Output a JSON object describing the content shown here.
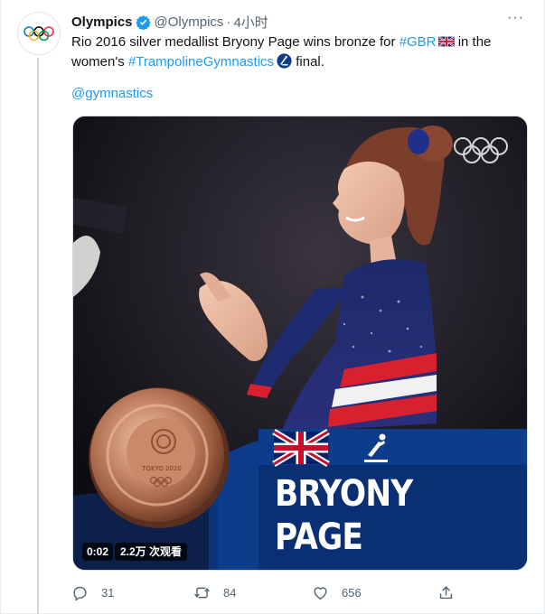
{
  "tweet": {
    "author_name": "Olympics",
    "handle": "@Olympics",
    "separator": "·",
    "time": "4小时",
    "more_label": "···",
    "text_part1": "Rio 2016 silver medallist Bryony Page wins bronze for ",
    "hashtag1": "#GBR",
    "text_part2": " in the women's ",
    "hashtag2": "#TrampolineGymnastics",
    "text_part3": " final.",
    "mention": "@gymnastics"
  },
  "media": {
    "athlete_first_name": "BRYONY",
    "athlete_last_name": "PAGE",
    "medal_inscription": "TOKYO 2020",
    "video_time": "0:02",
    "video_views": "2.2万 次观看"
  },
  "actions": {
    "reply_count": "31",
    "retweet_count": "84",
    "like_count": "656"
  },
  "icons": [
    "verified-badge-icon",
    "more-options-icon",
    "uk-flag-icon",
    "trampoline-hashflag-icon",
    "olympic-rings-icon",
    "reply-icon",
    "retweet-icon",
    "like-icon",
    "share-icon"
  ],
  "colors": {
    "link": "#1d9bf0",
    "muted": "#536471",
    "broadcast_blue": "#0d3c8a",
    "lower_third_navy": "#0a2f72"
  }
}
